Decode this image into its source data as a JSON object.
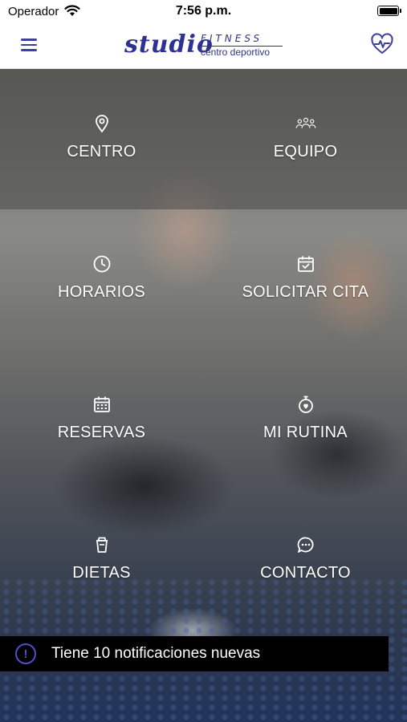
{
  "status_bar": {
    "carrier": "Operador",
    "time": "7:56 p.m.",
    "battery_level": 1.0
  },
  "header": {
    "logo": {
      "primary": "studio",
      "secondary": "FITNESS",
      "subtitle": "centro deportivo"
    },
    "menu_icon": "hamburger-menu-icon",
    "right_icon": "heart-pulse-icon"
  },
  "menu": {
    "items": [
      {
        "label": "CENTRO",
        "icon": "location-pin-icon"
      },
      {
        "label": "EQUIPO",
        "icon": "team-icon"
      },
      {
        "label": "HORARIOS",
        "icon": "clock-icon"
      },
      {
        "label": "SOLICITAR CITA",
        "icon": "calendar-check-icon"
      },
      {
        "label": "RESERVAS",
        "icon": "calendar-grid-icon"
      },
      {
        "label": "MI RUTINA",
        "icon": "stopwatch-icon"
      },
      {
        "label": "DIETAS",
        "icon": "drink-cup-icon"
      },
      {
        "label": "CONTACTO",
        "icon": "chat-bubble-icon"
      }
    ]
  },
  "notification": {
    "text": "Tiene 10 notificaciones nuevas",
    "icon": "alert-circle-icon"
  },
  "colors": {
    "brand": "#2d3192",
    "notification_bg": "#000000",
    "notification_icon": "#4b52c8"
  }
}
